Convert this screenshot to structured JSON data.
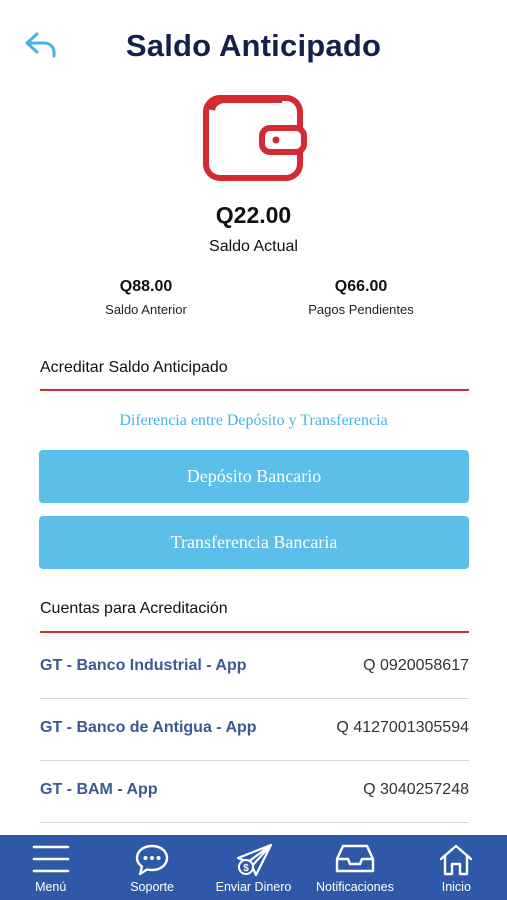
{
  "header": {
    "title": "Saldo Anticipado",
    "back_icon": "back-arrow-icon"
  },
  "balance": {
    "icon": "wallet-icon",
    "amount": "Q22.00",
    "label": "Saldo Actual",
    "previous_amount": "Q88.00",
    "previous_label": "Saldo Anterior",
    "pending_amount": "Q66.00",
    "pending_label": "Pagos Pendientes"
  },
  "credit_section": {
    "title": "Acreditar Saldo Anticipado",
    "difference_link": "Diferencia entre Depósito y Transferencia",
    "deposit_button": "Depósito Bancario",
    "transfer_button": "Transferencia Bancaria"
  },
  "accounts_section": {
    "title": "Cuentas para Acreditación",
    "accounts": [
      {
        "name": "GT - Banco Industrial - App",
        "number": "Q 0920058617"
      },
      {
        "name": "GT - Banco de Antigua - App",
        "number": "Q 4127001305594"
      },
      {
        "name": "GT - BAM - App",
        "number": "Q 3040257248"
      }
    ]
  },
  "tabbar": {
    "items": [
      {
        "label": "Menú",
        "icon": "hamburger-menu-icon"
      },
      {
        "label": "Soporte",
        "icon": "chat-bubble-icon"
      },
      {
        "label": "Enviar Dinero",
        "icon": "paper-plane-money-icon"
      },
      {
        "label": "Notificaciones",
        "icon": "inbox-tray-icon"
      },
      {
        "label": "Inicio",
        "icon": "home-icon"
      }
    ]
  },
  "colors": {
    "title": "#14214a",
    "accent_red": "#d42a32",
    "link_blue": "#48b3e4",
    "button_blue": "#5bbfe9",
    "account_blue": "#3b5a8f",
    "tabbar_blue": "#2f58a8"
  }
}
